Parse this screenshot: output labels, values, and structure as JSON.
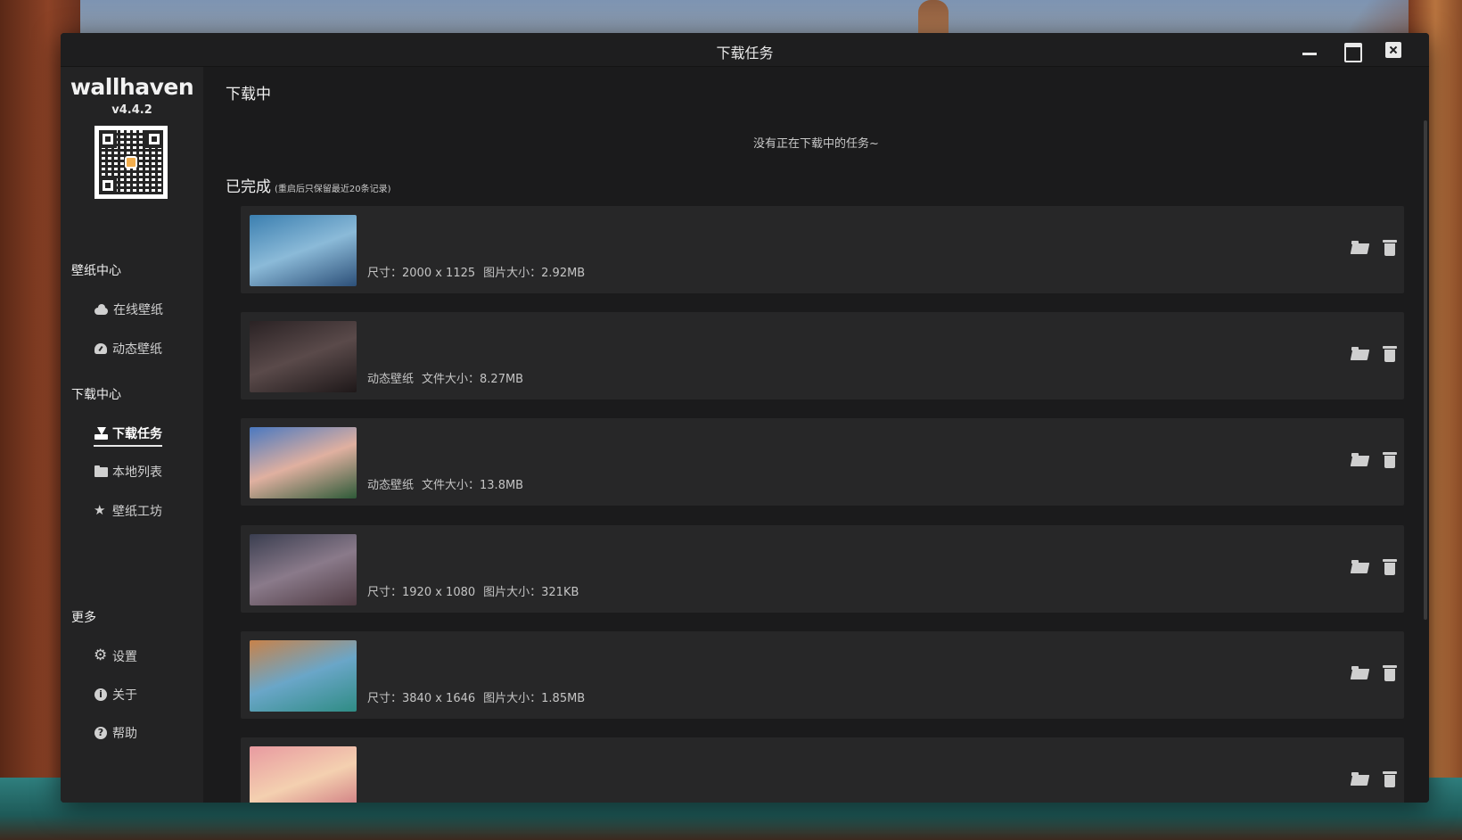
{
  "window": {
    "title": "下载任务",
    "controls": [
      "minimize-icon",
      "maximize-icon",
      "close-icon"
    ]
  },
  "sidebar": {
    "brand": "wallhaven",
    "version": "v4.4.2",
    "sections": [
      {
        "title": "壁纸中心",
        "items": [
          {
            "label": "在线壁纸",
            "icon": "cloud-icon"
          },
          {
            "label": "动态壁纸",
            "icon": "gauge-icon"
          }
        ]
      },
      {
        "title": "下载中心",
        "items": [
          {
            "label": "下载任务",
            "icon": "download-icon",
            "active": true
          },
          {
            "label": "本地列表",
            "icon": "folder-icon"
          },
          {
            "label": "壁纸工坊",
            "icon": "star-icon"
          }
        ]
      },
      {
        "title": "更多",
        "items": [
          {
            "label": "设置",
            "icon": "gear-icon"
          },
          {
            "label": "关于",
            "icon": "info-icon"
          },
          {
            "label": "帮助",
            "icon": "help-icon"
          }
        ]
      }
    ]
  },
  "downloading": {
    "title": "下载中",
    "empty_message": "没有正在下载中的任务~"
  },
  "completed": {
    "title": "已完成",
    "note": "(重启后只保留最近20条记录)",
    "items": [
      {
        "info": [
          "尺寸：2000 x 1125",
          "图片大小：2.92MB"
        ],
        "thumb_colors": [
          "#3b7fb0",
          "#8bbad8",
          "#2c4f78"
        ]
      },
      {
        "info": [
          "动态壁纸",
          "文件大小：8.27MB"
        ],
        "thumb_colors": [
          "#2a2224",
          "#5a4a4a",
          "#1e1819"
        ]
      },
      {
        "info": [
          "动态壁纸",
          "文件大小：13.8MB"
        ],
        "thumb_colors": [
          "#4a78c0",
          "#e0b0a0",
          "#2e5a38"
        ]
      },
      {
        "info": [
          "尺寸：1920 x 1080",
          "图片大小：321KB"
        ],
        "thumb_colors": [
          "#3a3e50",
          "#8a7a8a",
          "#4e3a42"
        ]
      },
      {
        "info": [
          "尺寸：3840 x 1646",
          "图片大小：1.85MB"
        ],
        "thumb_colors": [
          "#c8824a",
          "#6aa6c8",
          "#2f8c84"
        ]
      },
      {
        "info": [],
        "thumb_colors": [
          "#e89aa0",
          "#f4d0b0",
          "#c86a78"
        ]
      }
    ]
  },
  "actions": {
    "open_folder": "folder-open-icon",
    "delete": "trash-icon"
  }
}
